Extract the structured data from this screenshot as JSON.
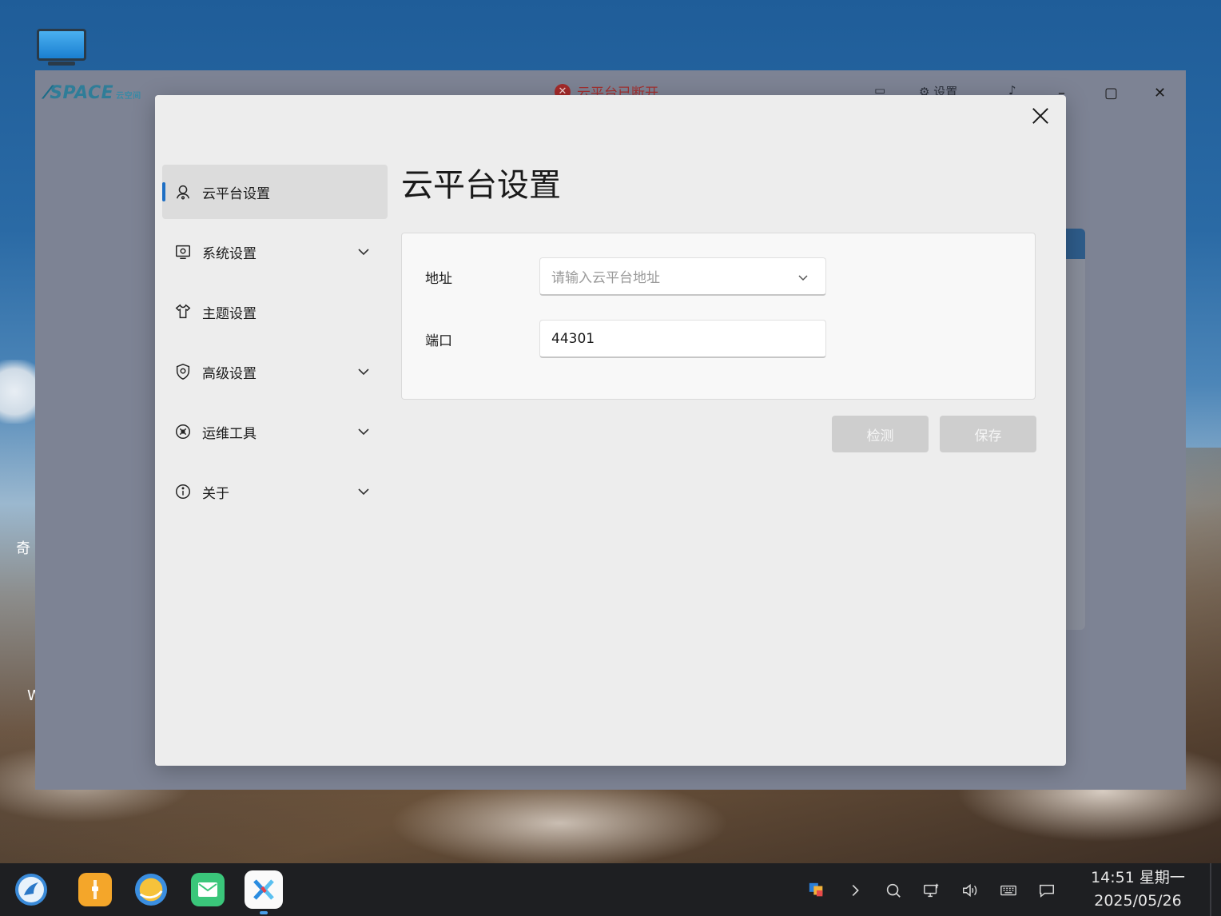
{
  "desktop": {
    "icon_name": "monitor-icon",
    "partial_text_1": "奇",
    "partial_text_2": "W"
  },
  "app": {
    "logo_text": "SPACE",
    "logo_sub": "云空间",
    "status_text": "云平台已断开",
    "settings_label": "设置",
    "window_controls": [
      "minimize",
      "maximize",
      "close"
    ]
  },
  "modal": {
    "title": "云平台设置",
    "nav": [
      {
        "label": "云平台设置",
        "icon": "cloud-person-icon",
        "active": true,
        "expandable": false
      },
      {
        "label": "系统设置",
        "icon": "system-settings-icon",
        "active": false,
        "expandable": true
      },
      {
        "label": "主题设置",
        "icon": "shirt-icon",
        "active": false,
        "expandable": false
      },
      {
        "label": "高级设置",
        "icon": "shield-icon",
        "active": false,
        "expandable": true
      },
      {
        "label": "运维工具",
        "icon": "tools-icon",
        "active": false,
        "expandable": true
      },
      {
        "label": "关于",
        "icon": "info-icon",
        "active": false,
        "expandable": true
      }
    ],
    "form": {
      "address_label": "地址",
      "address_placeholder": "请输入云平台地址",
      "port_label": "端口",
      "port_value": "44301"
    },
    "buttons": {
      "detect": "检测",
      "save": "保存"
    }
  },
  "taskbar": {
    "apps": [
      "start-menu-icon",
      "file-manager-icon",
      "browser-icon",
      "mail-icon",
      "remote-desktop-icon"
    ],
    "tray": [
      "color-tray-icon",
      "chevron-right-icon",
      "search-icon",
      "network-icon",
      "volume-icon",
      "keyboard-icon",
      "notification-icon"
    ],
    "time": "14:51 星期一",
    "date": "2025/05/26"
  },
  "colors": {
    "accent": "#1e6fc4",
    "error": "#a32a2a",
    "button_disabled": "#cecece"
  }
}
